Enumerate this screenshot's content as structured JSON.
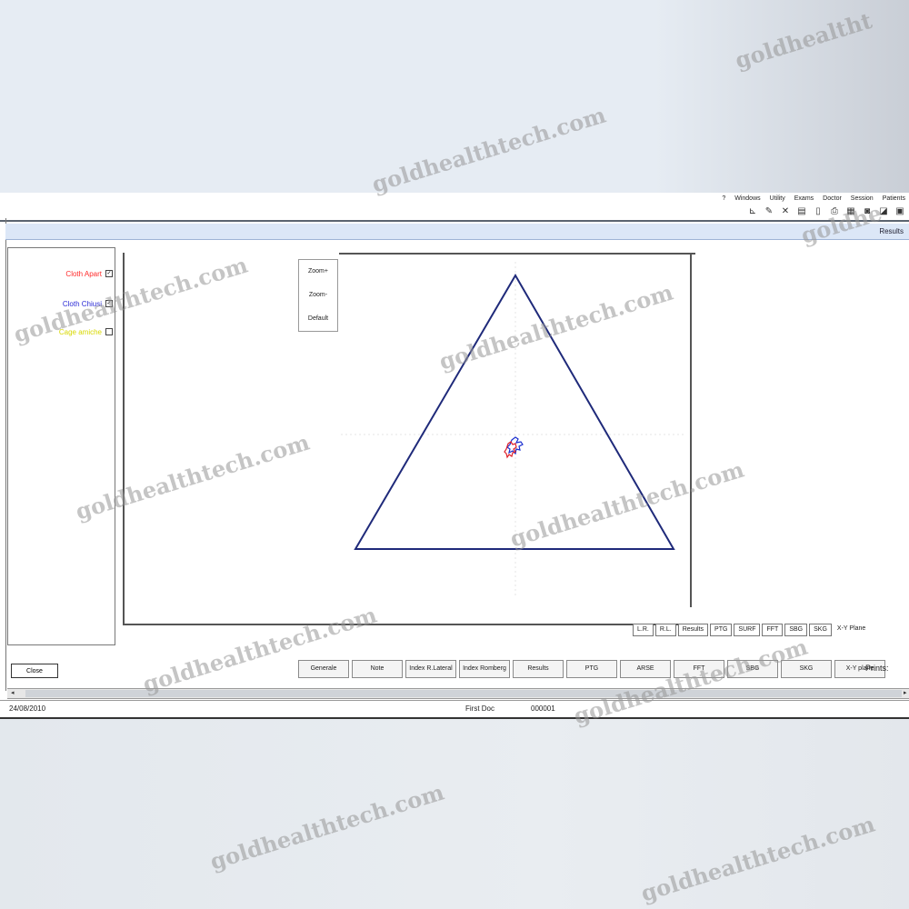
{
  "menu": [
    "Patients",
    "Session",
    "Doctor",
    "Exams",
    "Utility",
    "Windows",
    "?"
  ],
  "toolbar_icons": [
    "new-icon",
    "open-icon",
    "save-icon",
    "grid-icon",
    "print-icon",
    "document-icon",
    "disk-icon",
    "tools-icon",
    "pen-icon",
    "chart-icon"
  ],
  "window": {
    "title": "Results"
  },
  "legend": [
    {
      "label": "Cloth Apart",
      "checked": true,
      "color": "#ff2a2a"
    },
    {
      "label": "Cloth Chiusi",
      "checked": true,
      "color": "#2b2bd6"
    },
    {
      "label": "Cage amiche",
      "checked": false,
      "color": "#e8e800"
    }
  ],
  "zoom": {
    "zoom_plus": "Zoom+",
    "zoom_minus": "Zoom-",
    "default": "Default"
  },
  "plot": {
    "triangle_color": "#1f2a7a",
    "cluster_colors": [
      "#1b2fd0",
      "#e0202a"
    ]
  },
  "tabs": [
    "X-Y Plane",
    "SKG",
    "SBG",
    "FFT",
    "SURF",
    "PTG",
    "Results",
    "R.L.",
    "L.R."
  ],
  "prints": {
    "label": "Prints:",
    "buttons": [
      "X-Y plane",
      "SKG",
      "SBG",
      "FFT",
      "ARSE",
      "PTG",
      "Results",
      "Index Romberg",
      "Index R.Lateral",
      "Note",
      "Generale"
    ]
  },
  "close_label": "Close",
  "statusbar": {
    "date": "24/08/2010",
    "code": "000001",
    "doctor": "First Doc"
  },
  "watermark": "goldhealthtech.com",
  "watermark_partial_1": "goldhealtht",
  "watermark_partial_2": "goldhe"
}
